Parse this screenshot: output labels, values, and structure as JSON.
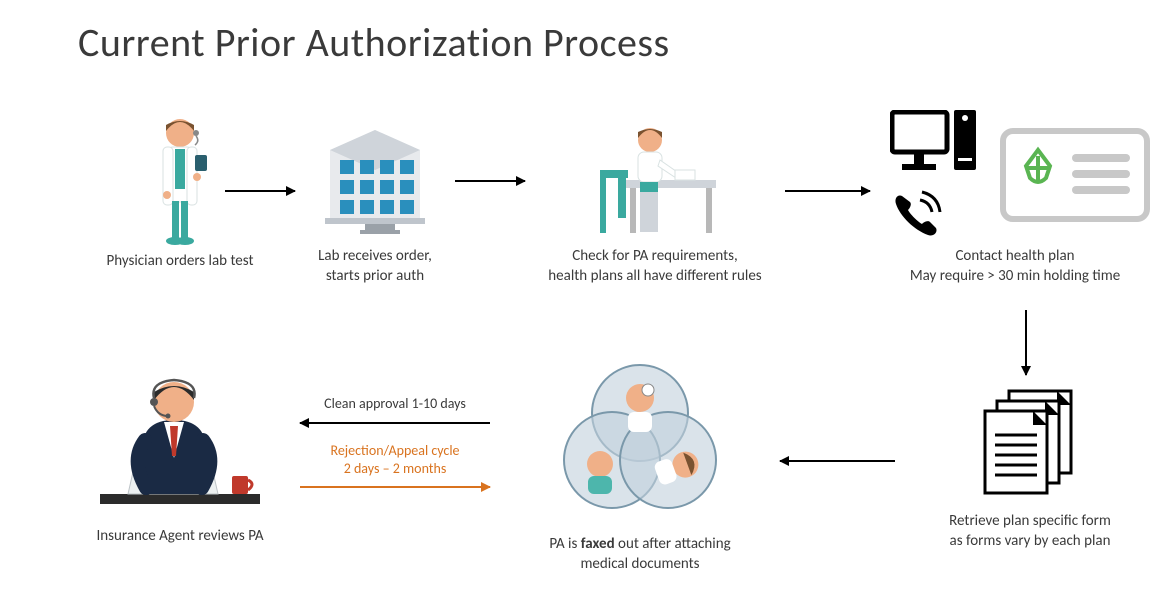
{
  "title": "Current Prior Authorization Process",
  "steps": {
    "physician": "Physician orders lab test",
    "lab_line1": "Lab receives order,",
    "lab_line2": "starts prior auth",
    "check_line1": "Check for PA requirements,",
    "check_line2": "health plans all have different rules",
    "contact_line1": "Contact health plan",
    "contact_line2": "May require > 30 min holding time",
    "retrieve_line1": "Retrieve plan specific form",
    "retrieve_line2": "as forms vary by each plan",
    "fax_line1_pre": "PA is ",
    "fax_line1_bold": "faxed",
    "fax_line1_post": " out after attaching",
    "fax_line2": "medical documents",
    "agent": "Insurance Agent reviews PA"
  },
  "arrows": {
    "approval": "Clean approval 1-10 days",
    "rejection_line1": "Rejection/Appeal cycle",
    "rejection_line2": "2 days – 2 months"
  },
  "colors": {
    "orange": "#d9731f",
    "teal": "#4db6ac",
    "blue": "#1976d2",
    "grey": "#b0b0b0",
    "dark": "#333333",
    "skin": "#f0b088",
    "hair": "#7a5230",
    "green": "#5ab552"
  }
}
